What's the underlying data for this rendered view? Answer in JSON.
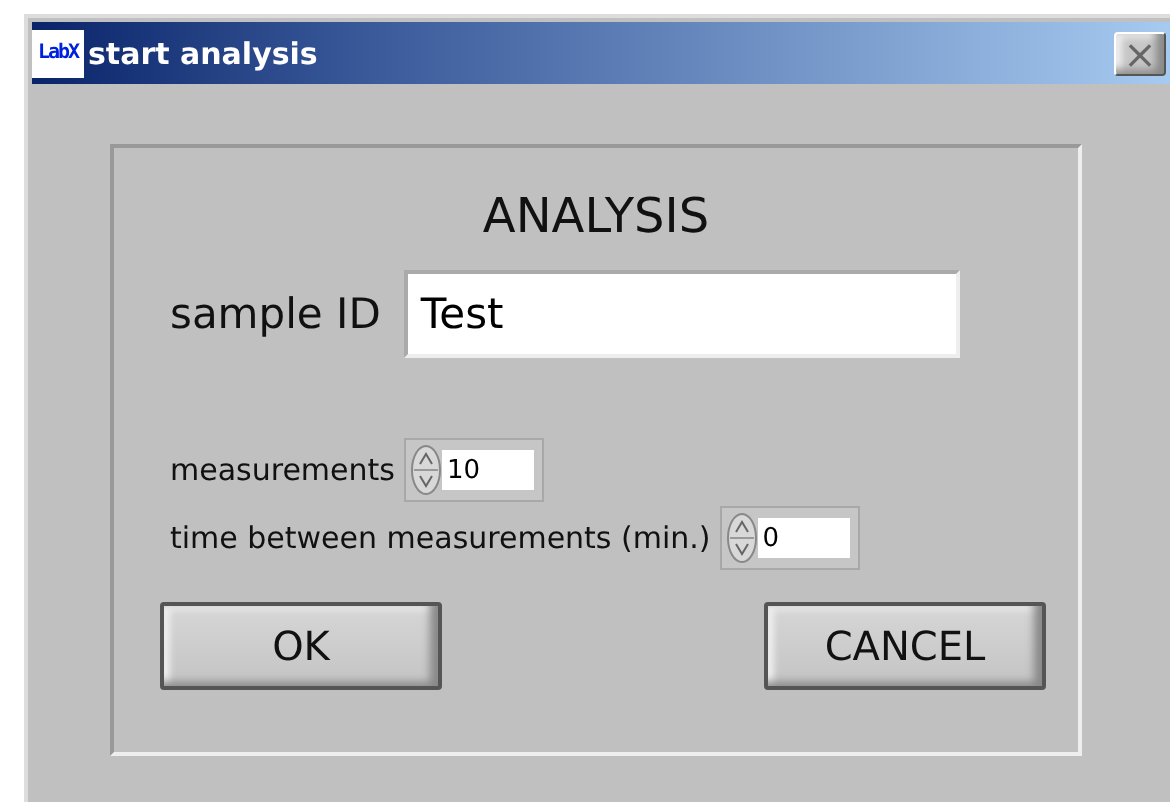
{
  "window": {
    "icon_text": "LabX",
    "title": "start analysis",
    "close": "×"
  },
  "heading": "ANALYSIS",
  "sample_id": {
    "label": "sample ID",
    "value": "Test"
  },
  "numeric_fields": [
    {
      "label": "measurements",
      "value": "10"
    },
    {
      "label": "time between measurements (min.)",
      "value": "0"
    }
  ],
  "buttons": [
    "OK",
    "CANCEL"
  ]
}
